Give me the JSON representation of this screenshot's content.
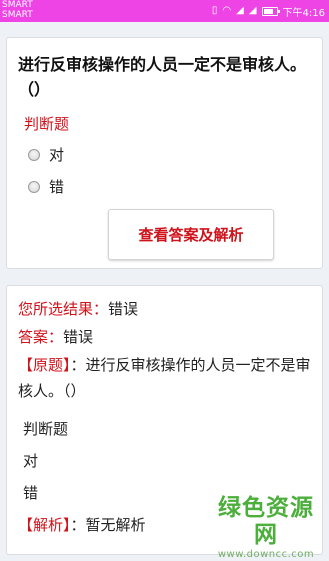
{
  "status_bar": {
    "carrier_1": "SMART",
    "carrier_2": "SMART",
    "time": "下午4:16"
  },
  "question": {
    "title": "进行反审核操作的人员一定不是审核人。（）",
    "type_label": "判断题",
    "options": [
      "对",
      "错"
    ],
    "show_answer_button": "查看答案及解析"
  },
  "result": {
    "your_choice_label": "您所选结果：",
    "your_choice_value": "错误",
    "answer_label": "答案：",
    "answer_value": "错误",
    "original_tag": "【原题】",
    "original_text": "：进行反审核操作的人员一定不是审核人。（）",
    "original_type": "判断题",
    "original_options": [
      "对",
      "错"
    ],
    "analysis_tag": "【解析】",
    "analysis_text": "：暂无解析"
  },
  "watermark": {
    "main": "绿色资源网",
    "sub": "www.downcc.com"
  }
}
